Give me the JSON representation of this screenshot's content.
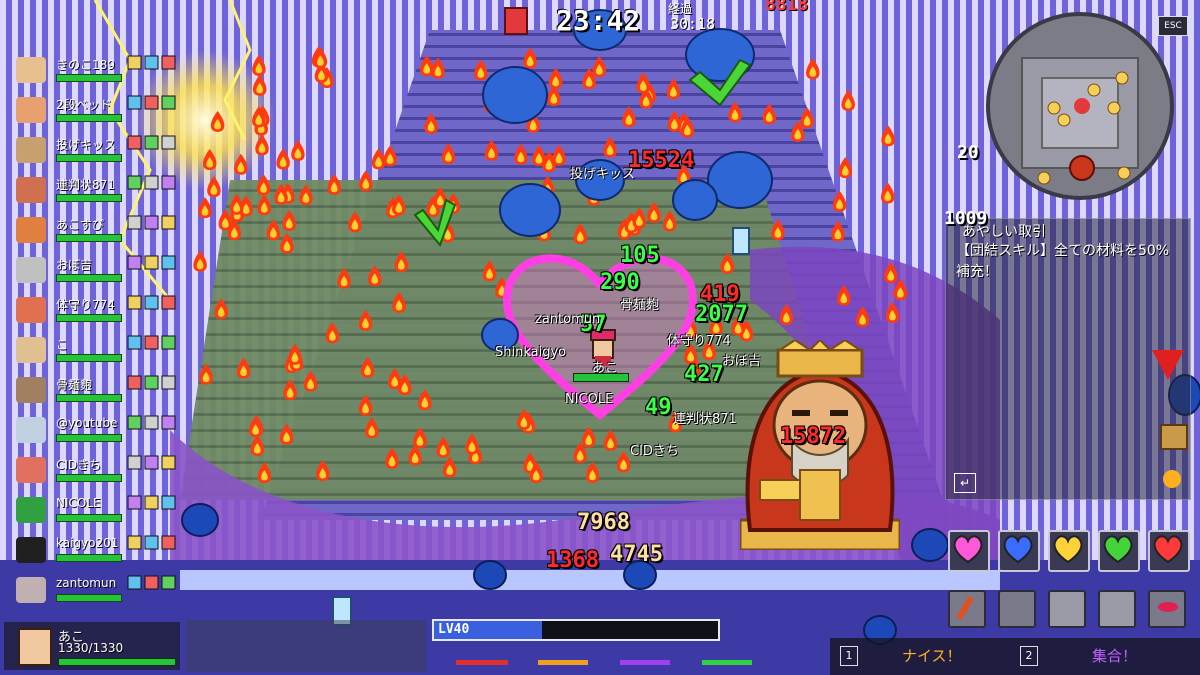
{
  "hud": {
    "timer": "23:42",
    "elapsed_label": "経過",
    "elapsed_value": "30:18",
    "top_score": "8818",
    "esc_label": "ESC",
    "minimap_count": "20",
    "level_label": "LV40",
    "level_progress": 0.38
  },
  "party": [
    {
      "name": "きのこ189"
    },
    {
      "name": "2段ベッド"
    },
    {
      "name": "投げキッス"
    },
    {
      "name": "連判状871"
    },
    {
      "name": "あこすぴ"
    },
    {
      "name": "おぼ吉"
    },
    {
      "name": "体守り774"
    },
    {
      "name": "こ"
    },
    {
      "name": "骨麺麭"
    },
    {
      "name": "@youtube"
    },
    {
      "name": "CIDきち"
    },
    {
      "name": "NICOLE"
    },
    {
      "name": "kaigyo201"
    },
    {
      "name": "zantomun"
    }
  ],
  "player": {
    "name": "あこ",
    "hp_text": "1330/1330"
  },
  "notice": {
    "title": "あやしい取引",
    "body": "【団結スキル】全ての材料を50%補充！",
    "partial_number": "1009"
  },
  "damage_numbers": [
    {
      "value": "15524",
      "color": "red"
    },
    {
      "value": "105",
      "color": "green"
    },
    {
      "value": "290",
      "color": "green"
    },
    {
      "value": "57",
      "color": "green"
    },
    {
      "value": "419",
      "color": "red"
    },
    {
      "value": "2077",
      "color": "green"
    },
    {
      "value": "427",
      "color": "green"
    },
    {
      "value": "49",
      "color": "green"
    },
    {
      "value": "15872",
      "color": "red"
    },
    {
      "value": "7968",
      "color": "ora"
    },
    {
      "value": "1368",
      "color": "red"
    },
    {
      "value": "4745",
      "color": "ora"
    }
  ],
  "floating_names": [
    "投げキッス",
    "zantomun",
    "骨麺麭",
    "Shinkaigyo",
    "あこ",
    "体守り774",
    "おぼ吉",
    "NICOLE",
    "連判状871",
    "CIDきち"
  ],
  "chat": {
    "key1": "1",
    "btn1": "ナイス！",
    "key2": "2",
    "btn2": "集合！"
  },
  "icons": {
    "boss": "daruma-king-icon",
    "heart": "heart-aura-icon",
    "fire": "flame-icon"
  },
  "colors": {
    "bg": "#5b4fc7",
    "damage_red": "#ff2a2a",
    "heal_green": "#3cff4a",
    "aura_pink": "#ff4fe0"
  }
}
